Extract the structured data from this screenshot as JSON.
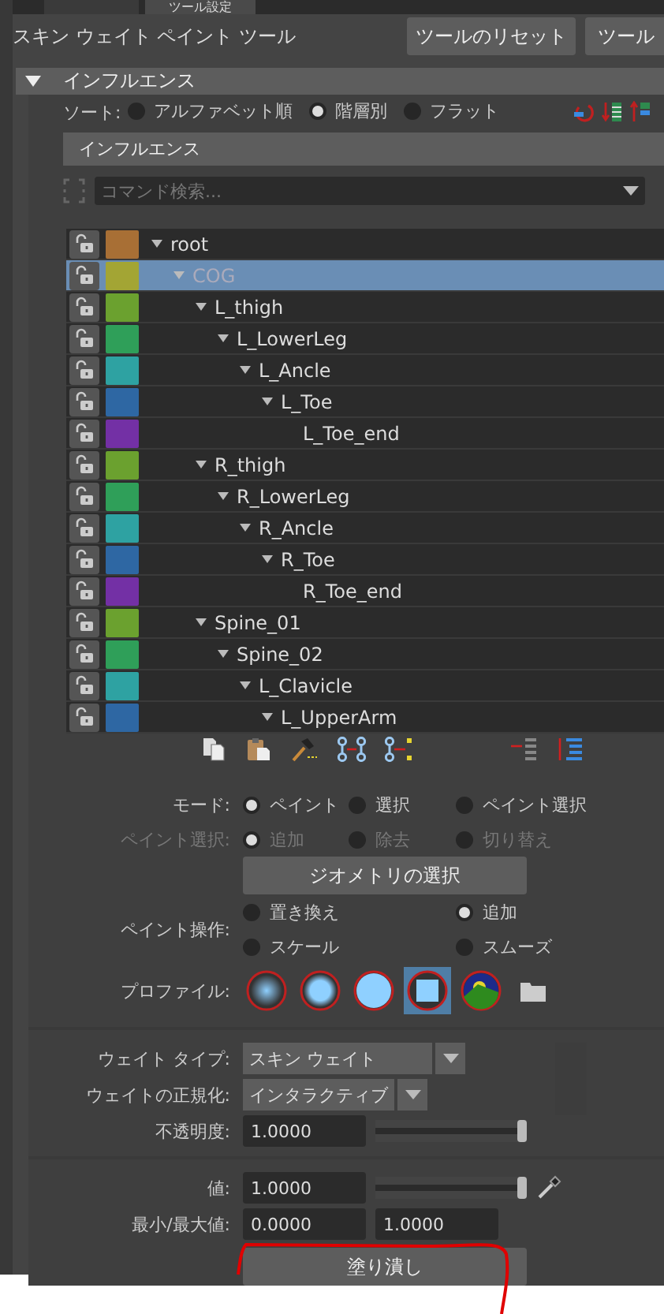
{
  "tabs": [
    {
      "selected": false
    },
    {
      "label": "ツール設定",
      "selected": true
    }
  ],
  "tool": {
    "title": "スキン ウェイト ペイント ツール",
    "buttons": [
      "ツールのリセット",
      "ツール"
    ]
  },
  "influence_section": {
    "title": "インフルエンス"
  },
  "sort": {
    "label": "ソート:",
    "options": [
      {
        "label": "アルファベット順",
        "selected": false
      },
      {
        "label": "階層別",
        "selected": true
      },
      {
        "label": "フラット",
        "selected": false
      }
    ]
  },
  "influence_list": {
    "title": "インフルエンス",
    "search_placeholder": "コマンド検索...",
    "tree": [
      {
        "name": "root",
        "color": "#a86f35",
        "selected": false,
        "expanded": true,
        "children": [
          {
            "name": "COG",
            "color": "#a3a534",
            "selected": true,
            "expanded": true,
            "children": [
              {
                "name": "L_thigh",
                "color": "#6ba12f",
                "selected": false,
                "expanded": true,
                "children": [
                  {
                    "name": "L_LowerLeg",
                    "color": "#2f9f59",
                    "selected": false,
                    "expanded": true,
                    "children": [
                      {
                        "name": "L_Ancle",
                        "color": "#2ea2a2",
                        "selected": false,
                        "expanded": true,
                        "children": [
                          {
                            "name": "L_Toe",
                            "color": "#2e67a3",
                            "selected": false,
                            "expanded": true,
                            "children": [
                              {
                                "name": "L_Toe_end",
                                "color": "#7330a5",
                                "selected": false,
                                "expanded": false
                              }
                            ]
                          }
                        ]
                      }
                    ]
                  }
                ]
              },
              {
                "name": "R_thigh",
                "color": "#6ba12f",
                "selected": false,
                "expanded": true,
                "children": [
                  {
                    "name": "R_LowerLeg",
                    "color": "#2f9f59",
                    "selected": false,
                    "expanded": true,
                    "children": [
                      {
                        "name": "R_Ancle",
                        "color": "#2ea2a2",
                        "selected": false,
                        "expanded": true,
                        "children": [
                          {
                            "name": "R_Toe",
                            "color": "#2e67a3",
                            "selected": false,
                            "expanded": true,
                            "children": [
                              {
                                "name": "R_Toe_end",
                                "color": "#7330a5",
                                "selected": false,
                                "expanded": false
                              }
                            ]
                          }
                        ]
                      }
                    ]
                  }
                ]
              },
              {
                "name": "Spine_01",
                "color": "#6ba12f",
                "selected": false,
                "expanded": true,
                "children": [
                  {
                    "name": "Spine_02",
                    "color": "#2f9f59",
                    "selected": false,
                    "expanded": true,
                    "children": [
                      {
                        "name": "L_Clavicle",
                        "color": "#2ea2a2",
                        "selected": false,
                        "expanded": true,
                        "children": [
                          {
                            "name": "L_UpperArm",
                            "color": "#2e67a3",
                            "selected": false,
                            "expanded": true
                          }
                        ]
                      }
                    ]
                  }
                ]
              }
            ]
          }
        ]
      }
    ]
  },
  "mode": {
    "label": "モード:",
    "options": [
      {
        "label": "ペイント",
        "selected": true
      },
      {
        "label": "選択",
        "selected": false
      },
      {
        "label": "ペイント選択",
        "selected": false
      }
    ]
  },
  "paint_select": {
    "label": "ペイント選択:",
    "disabled": true,
    "options": [
      {
        "label": "追加",
        "selected": true
      },
      {
        "label": "除去",
        "selected": false
      },
      {
        "label": "切り替え",
        "selected": false
      }
    ]
  },
  "select_geometry_button": "ジオメトリの選択",
  "paint_operation": {
    "label": "ペイント操作:",
    "options": [
      {
        "label": "置き換え",
        "selected": false
      },
      {
        "label": "追加",
        "selected": true
      },
      {
        "label": "スケール",
        "selected": false
      },
      {
        "label": "スムーズ",
        "selected": false
      }
    ]
  },
  "profile": {
    "label": "プロファイル:",
    "options": [
      {
        "kind": "soft",
        "selected": false
      },
      {
        "kind": "medium",
        "selected": false
      },
      {
        "kind": "solid",
        "selected": false
      },
      {
        "kind": "square",
        "selected": true
      },
      {
        "kind": "image",
        "selected": false
      }
    ]
  },
  "weight_type": {
    "label": "ウェイト タイプ:",
    "value": "スキン ウェイト"
  },
  "normalize": {
    "label": "ウェイトの正規化:",
    "value": "インタラクティブ"
  },
  "opacity": {
    "label": "不透明度:",
    "value": "1.0000",
    "level": 1
  },
  "value": {
    "label": "値:",
    "value": "1.0000",
    "level": 1
  },
  "min_max": {
    "label": "最小/最大値:",
    "min": "0.0000",
    "max": "1.0000"
  },
  "flood_button": "塗り潰し"
}
